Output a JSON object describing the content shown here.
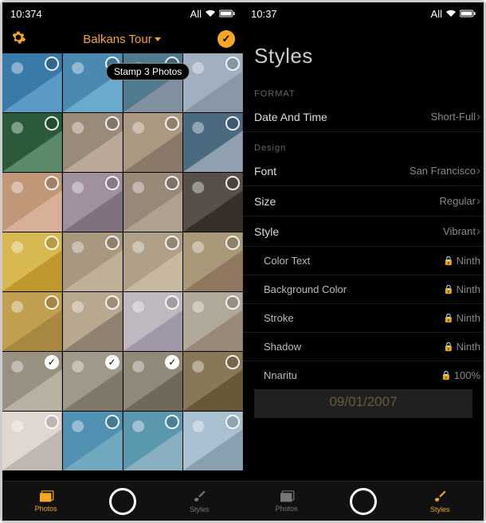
{
  "status": {
    "time_left": "10:374",
    "time_right": "10:37",
    "carrier": "All"
  },
  "left": {
    "album_title": "Balkans Tour",
    "stamp_badge": "Stamp 3 Photos",
    "tabs": {
      "photos": "Photos",
      "styles": "Styles"
    },
    "thumbs": [
      {
        "sel": false,
        "c1": "#3a7aa8",
        "c2": "#5a9ac4"
      },
      {
        "sel": false,
        "c1": "#4a8ab0",
        "c2": "#6aaacd"
      },
      {
        "sel": false,
        "c1": "#507a90",
        "c2": "#8090a0"
      },
      {
        "sel": false,
        "c1": "#a0b0c0",
        "c2": "#8898a8"
      },
      {
        "sel": false,
        "c1": "#2a5a3a",
        "c2": "#5a8a6a"
      },
      {
        "sel": false,
        "c1": "#9a8a7a",
        "c2": "#baa898"
      },
      {
        "sel": false,
        "c1": "#aa9880",
        "c2": "#8a7868"
      },
      {
        "sel": false,
        "c1": "#4a6a80",
        "c2": "#90a0b0"
      },
      {
        "sel": false,
        "c1": "#c09878",
        "c2": "#d8b098"
      },
      {
        "sel": false,
        "c1": "#a090a0",
        "c2": "#807080"
      },
      {
        "sel": false,
        "c1": "#988878",
        "c2": "#b0a090"
      },
      {
        "sel": false,
        "c1": "#585048",
        "c2": "#383028"
      },
      {
        "sel": false,
        "c1": "#d8b850",
        "c2": "#c09830"
      },
      {
        "sel": false,
        "c1": "#a89880",
        "c2": "#c0b098"
      },
      {
        "sel": false,
        "c1": "#b0a088",
        "c2": "#c8b8a0"
      },
      {
        "sel": false,
        "c1": "#a89878",
        "c2": "#907860"
      },
      {
        "sel": false,
        "c1": "#c0a050",
        "c2": "#a88840"
      },
      {
        "sel": false,
        "c1": "#b8a890",
        "c2": "#908070"
      },
      {
        "sel": false,
        "c1": "#c0b8c0",
        "c2": "#a098a8"
      },
      {
        "sel": false,
        "c1": "#b0a898",
        "c2": "#988878"
      },
      {
        "sel": true,
        "c1": "#989080",
        "c2": "#b8b0a0"
      },
      {
        "sel": true,
        "c1": "#a09888",
        "c2": "#807868"
      },
      {
        "sel": true,
        "c1": "#908878",
        "c2": "#706858"
      },
      {
        "sel": false,
        "c1": "#887858",
        "c2": "#685838"
      },
      {
        "sel": false,
        "c1": "#e0d8d0",
        "c2": "#c0b8b0"
      },
      {
        "sel": false,
        "c1": "#5090b0",
        "c2": "#70a8c0"
      },
      {
        "sel": false,
        "c1": "#5a98b0",
        "c2": "#88b0c0"
      },
      {
        "sel": false,
        "c1": "#a8c0d0",
        "c2": "#88a0b0"
      }
    ]
  },
  "right": {
    "title": "Styles",
    "sections": {
      "format_label": "FORMAT",
      "design_label": "Design"
    },
    "rows": {
      "datetime_label": "Date And Time",
      "datetime_value": "Short-Full",
      "font_label": "Font",
      "font_value": "San Francisco",
      "size_label": "Size",
      "size_value": "Regular",
      "style_label": "Style",
      "style_value": "Vibrant",
      "colortext_label": "Color Text",
      "colortext_value": "Ninth",
      "bgcolor_label": "Background Color",
      "bgcolor_value": "Ninth",
      "stroke_label": "Stroke",
      "stroke_value": "Ninth",
      "shadow_label": "Shadow",
      "shadow_value": "Ninth",
      "opacity_label": "Nnaritu",
      "opacity_value": "100%"
    },
    "preview_date": "09/01/2007",
    "tabs": {
      "photos": "Photos",
      "styles": "Styles"
    }
  }
}
